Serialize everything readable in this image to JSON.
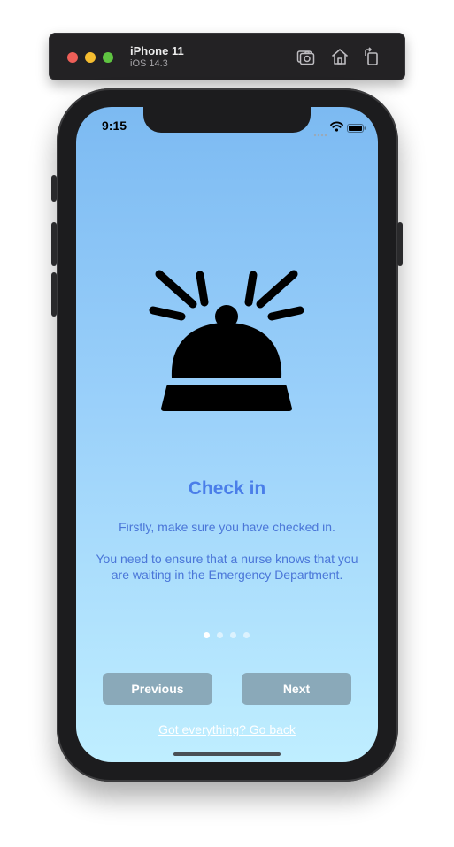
{
  "simulator": {
    "device_name": "iPhone 11",
    "os_version": "iOS 14.3",
    "toolbar_icons": [
      "screenshot-icon",
      "home-icon",
      "rotate-icon"
    ]
  },
  "status_bar": {
    "time": "9:15",
    "icons": [
      "cellular-signal-icon",
      "wifi-icon",
      "battery-icon"
    ]
  },
  "onboarding": {
    "illustration": "service-bell-icon",
    "title": "Check in",
    "paragraph_1": "Firstly, make sure you have checked in.",
    "paragraph_2": "You need to ensure that a nurse knows that you are waiting in the Emergency Department.",
    "page_indicator": {
      "total": 4,
      "current": 1
    },
    "previous_label": "Previous",
    "next_label": "Next",
    "go_back_label": "Got everything? Go back"
  },
  "colors": {
    "title": "#4a7ee9",
    "body_text": "#4a76d8",
    "button_bg": "#8aa9b9",
    "gradient_top": "#7cbaf2",
    "gradient_bottom": "#bfeeff"
  }
}
